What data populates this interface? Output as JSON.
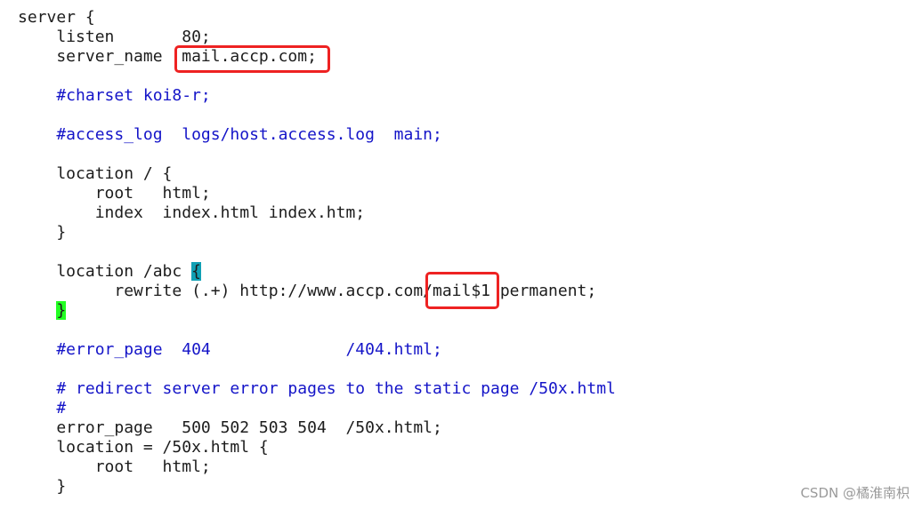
{
  "editor": {
    "lines": [
      [
        {
          "t": "server {"
        }
      ],
      [
        {
          "t": "    listen       80;"
        }
      ],
      [
        {
          "t": "    server_name  mail.accp.com;"
        }
      ],
      [],
      [
        {
          "t": "    #charset koi8-r;",
          "s": "comment"
        }
      ],
      [],
      [
        {
          "t": "    #access_log  logs/host.access.log  main;",
          "s": "comment"
        }
      ],
      [],
      [
        {
          "t": "    location / {"
        }
      ],
      [
        {
          "t": "        root   html;"
        }
      ],
      [
        {
          "t": "        index  index.html index.htm;"
        }
      ],
      [
        {
          "t": "    }"
        }
      ],
      [],
      [
        {
          "t": "    location /abc "
        },
        {
          "t": "{",
          "s": "hl-teal"
        }
      ],
      [
        {
          "t": "          rewrite (.+) http://www.accp.com/mail$1 permanent;"
        }
      ],
      [
        {
          "t": "    "
        },
        {
          "t": "}",
          "s": "hl-green"
        }
      ],
      [],
      [
        {
          "t": "    #error_page  404              /404.html;",
          "s": "comment"
        }
      ],
      [],
      [
        {
          "t": "    # redirect server error pages to the static page /50x.html",
          "s": "comment"
        }
      ],
      [
        {
          "t": "    #",
          "s": "comment"
        }
      ],
      [
        {
          "t": "    error_page   500 502 503 504  /50x.html;"
        }
      ],
      [
        {
          "t": "    location = /50x.html {"
        }
      ],
      [
        {
          "t": "        root   html;"
        }
      ],
      [
        {
          "t": "    }"
        }
      ]
    ]
  },
  "annotations": {
    "color": "#ee2222"
  },
  "colors": {
    "comment": "#1414c8",
    "brace_highlight": "#10a0b4",
    "close_brace_highlight": "#22ff22"
  },
  "watermark": "CSDN @橘淮南枳"
}
